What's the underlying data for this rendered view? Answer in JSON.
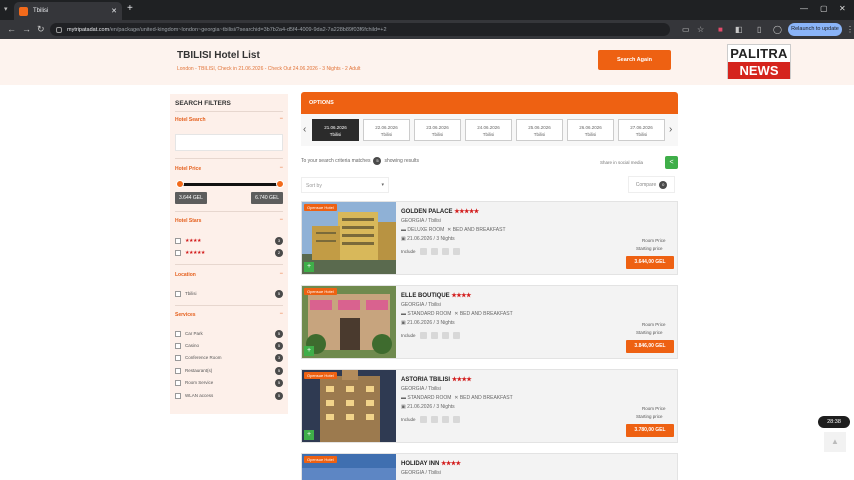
{
  "browser": {
    "tab_title": "Tbilisi",
    "url_host": "mytripatadat.com",
    "url_path": "/en/package/united-kingdom~london~georgia~tbilisi/?searchid=3b7b2a4-d5f4-4009-9da2-7a228b89f03f6fchild=+2",
    "relaunch_label": "Relaunch to update"
  },
  "header": {
    "title": "TBILISI Hotel List",
    "subtitle": "London - TBILISI, Check in 21.06.2026 - Check Out 24.06.2026 - 3 Nights - 2 Adult",
    "search_again": "Search Again",
    "logo_top": "PALITRA",
    "logo_bottom": "NEWS"
  },
  "filters": {
    "title": "SEARCH FILTERS",
    "hotel_search": "Hotel Search",
    "hotel_price": "Hotel Price",
    "price_min": "3.644 GEL",
    "price_max": "6.740 GEL",
    "hotel_stars": "Hotel Stars",
    "stars": [
      {
        "label": "★★★★",
        "count": "3"
      },
      {
        "label": "★★★★★",
        "count": "2"
      }
    ],
    "location": "Location",
    "locations": [
      {
        "label": "Tbilisi",
        "count": "5"
      }
    ],
    "services": "Services",
    "service_items": [
      {
        "label": "Car Park",
        "count": "5"
      },
      {
        "label": "Casino",
        "count": "5"
      },
      {
        "label": "Conference Room",
        "count": "3"
      },
      {
        "label": "Restaurant(s)",
        "count": "5"
      },
      {
        "label": "Room Service",
        "count": "5"
      },
      {
        "label": "WLAN access",
        "count": "5"
      }
    ]
  },
  "options": {
    "label": "OPTIONS",
    "dates": [
      {
        "date": "21.06.2026",
        "city": "Tbilisi"
      },
      {
        "date": "22.06.2026",
        "city": "Tbilisi"
      },
      {
        "date": "23.06.2026",
        "city": "Tbilisi"
      },
      {
        "date": "24.06.2026",
        "city": "Tbilisi"
      },
      {
        "date": "25.06.2026",
        "city": "Tbilisi"
      },
      {
        "date": "26.06.2026",
        "city": "Tbilisi"
      },
      {
        "date": "27.06.2026",
        "city": "Tbilisi"
      }
    ],
    "results_prefix": "To your search criteria matches",
    "results_count": "5",
    "results_suffix": "showing results",
    "share_text": "Share in social media",
    "sort_placeholder": "Sort by",
    "compare_label": "Compare",
    "compare_count": "0"
  },
  "hotels": [
    {
      "badge": "Opensue Hotel",
      "name": "GOLDEN PALACE",
      "stars": "★★★★★",
      "location": "GEORGIA / Tbilisi",
      "room": "DELUXE ROOM",
      "board": "BED AND BREAKFAST",
      "date": "21.06.2026 / 3 Nights",
      "include": "Include",
      "room_price_label": "Room Price",
      "starting_price_label": "Starting price",
      "price": "3.644,00 GEL"
    },
    {
      "badge": "Opensue Hotel",
      "name": "ELLE BOUTIQUE",
      "stars": "★★★★",
      "location": "GEORGIA / Tbilisi",
      "room": "STANDARD ROOM",
      "board": "BED AND BREAKFAST",
      "date": "21.06.2026 / 3 Nights",
      "include": "Include",
      "room_price_label": "Room Price",
      "starting_price_label": "Starting price",
      "price": "3.846,00 GEL"
    },
    {
      "badge": "Opensue Hotel",
      "name": "ASTORIA TBILISI",
      "stars": "★★★★",
      "location": "GEORGIA / Tbilisi",
      "room": "STANDARD ROOM",
      "board": "BED AND BREAKFAST",
      "date": "21.06.2026 / 3 Nights",
      "include": "Include",
      "room_price_label": "Room Price",
      "starting_price_label": "Starting price",
      "price": "3.780,00 GEL"
    },
    {
      "badge": "Opensue Hotel",
      "name": "HOLIDAY INN",
      "stars": "★★★★",
      "location": "GEORGIA / Tbilisi"
    }
  ],
  "video": {
    "timer": "28:38"
  },
  "colors": {
    "brand_orange": "#ee6112",
    "accent_green": "#3fae49",
    "star_red": "#d21b1b",
    "news_red": "#d5241d"
  }
}
